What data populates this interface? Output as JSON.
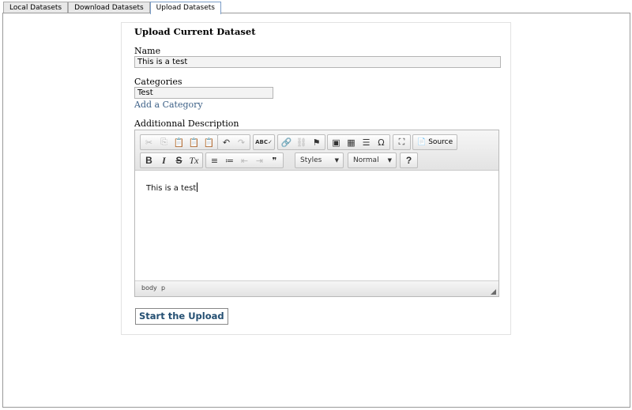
{
  "tabs": [
    {
      "label": "Local Datasets",
      "active": false
    },
    {
      "label": "Download Datasets",
      "active": false
    },
    {
      "label": "Upload Datasets",
      "active": true
    }
  ],
  "form": {
    "title": "Upload Current Dataset",
    "name_label": "Name",
    "name_value": "This is a test",
    "categories_label": "Categories",
    "categories_value": "Test",
    "add_category_link": "Add a Category",
    "description_label": "Additionnal Description",
    "submit_label": "Start the Upload"
  },
  "editor": {
    "content_text": "This is a test",
    "source_label": "Source",
    "styles_label": "Styles",
    "format_label": "Normal",
    "path": [
      "body",
      "p"
    ],
    "icons": {
      "cut": "✂",
      "copy": "⎘",
      "paste": "📋",
      "paste_text": "📋",
      "paste_word": "📋",
      "undo": "↶",
      "redo": "↷",
      "spellcheck": "ABC✓",
      "link": "🔗",
      "unlink": "⛓",
      "anchor": "⚑",
      "image": "▣",
      "table": "▦",
      "hr": "☰",
      "special_char": "Ω",
      "maximize": "⛶",
      "source": "📄",
      "bold": "B",
      "italic": "I",
      "strike": "S",
      "remove_format": "Tx",
      "numbered_list": "≡",
      "bulleted_list": "≔",
      "outdent": "⇤",
      "indent": "⇥",
      "blockquote": "❞",
      "help": "?"
    }
  },
  "colors": {
    "link": "#3b5f86",
    "submit_text": "#244f72",
    "active_tab_border": "#7a9cc6"
  }
}
